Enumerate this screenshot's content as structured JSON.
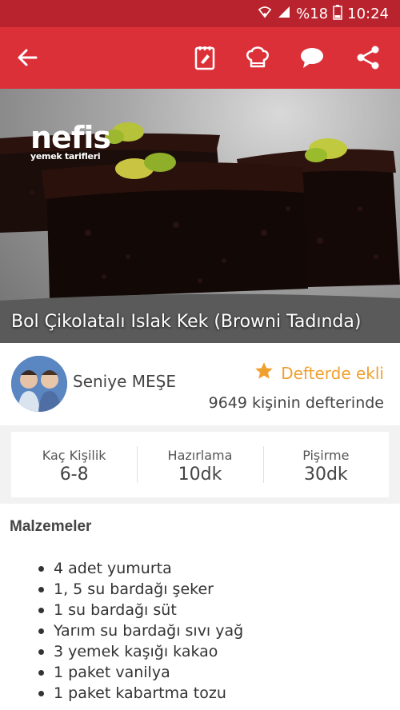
{
  "status_bar": {
    "battery_percent": "%18",
    "time": "10:24",
    "icons": [
      "wifi-icon",
      "signal-icon",
      "battery-icon"
    ]
  },
  "toolbar": {
    "icons": [
      "back-arrow-icon",
      "notebook-icon",
      "chef-hat-icon",
      "chat-bubble-icon",
      "share-icon"
    ],
    "color": "#dc3039"
  },
  "hero": {
    "brand_name": "nefis",
    "brand_sub": "yemek tarifleri",
    "title": "Bol Çikolatalı Islak Kek (Browni Tadında)"
  },
  "author": {
    "name": "Seniye MEŞE",
    "favorite_label": "Defterde ekli",
    "favorite_count": "9649 kişinin defterinde",
    "accent": "#f0a02f"
  },
  "stats": [
    {
      "label": "Kaç Kişilik",
      "value": "6-8"
    },
    {
      "label": "Hazırlama",
      "value": "10dk"
    },
    {
      "label": "Pişirme",
      "value": "30dk"
    }
  ],
  "ingredients": {
    "title": "Malzemeler",
    "items": [
      "4 adet yumurta",
      "1, 5 su bardağı şeker",
      "1 su bardağı süt",
      "Yarım su bardağı sıvı yağ",
      "3 yemek kaşığı kakao",
      "1 paket vanilya",
      "1 paket kabartma tozu"
    ]
  }
}
